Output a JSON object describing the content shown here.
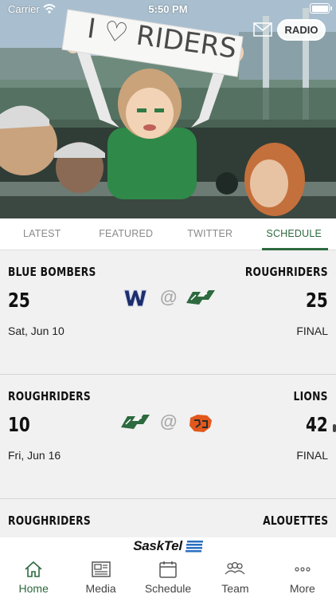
{
  "status_bar": {
    "carrier": "Carrier",
    "time": "5:50 PM"
  },
  "hero": {
    "sign_text": "I ♡ RIDERS",
    "radio_label": "RADIO"
  },
  "tabs": [
    {
      "label": "LATEST",
      "active": false
    },
    {
      "label": "FEATURED",
      "active": false
    },
    {
      "label": "TWITTER",
      "active": false
    },
    {
      "label": "SCHEDULE",
      "active": true
    }
  ],
  "games": [
    {
      "home_team": "BLUE BOMBERS",
      "away_team": "ROUGHRIDERS",
      "home_score": "25",
      "away_score": "25",
      "at": "@",
      "date": "Sat, Jun 10",
      "status": "FINAL"
    },
    {
      "home_team": "ROUGHRIDERS",
      "away_team": "LIONS",
      "home_score": "10",
      "away_score": "42",
      "at": "@",
      "date": "Fri, Jun 16",
      "status": "FINAL"
    },
    {
      "home_team": "ROUGHRIDERS",
      "away_team": "ALOUETTES",
      "home_score": "",
      "away_score": "",
      "at": "",
      "date": "",
      "status": ""
    }
  ],
  "sponsor": {
    "name": "SaskTel"
  },
  "nav": [
    {
      "label": "Home",
      "icon": "home-icon",
      "active": true
    },
    {
      "label": "Media",
      "icon": "media-icon",
      "active": false
    },
    {
      "label": "Schedule",
      "icon": "calendar-icon",
      "active": false
    },
    {
      "label": "Team",
      "icon": "team-icon",
      "active": false
    },
    {
      "label": "More",
      "icon": "more-icon",
      "active": false
    }
  ],
  "colors": {
    "accent": "#2d6a3f",
    "list_bg": "#f1f1f1",
    "bombers_blue": "#1c2e6b",
    "lions_orange": "#e2581c"
  }
}
